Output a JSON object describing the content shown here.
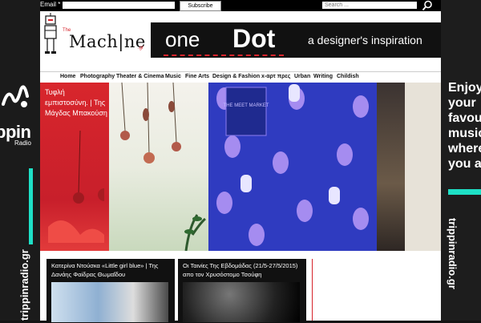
{
  "topbar": {
    "email_label": "Email *",
    "subscribe_label": "Subscribe",
    "search_placeholder": "Search ..."
  },
  "logo": {
    "small": "The",
    "text": "Mach|ne",
    "suffix": ".gr"
  },
  "banner": {
    "one": "one",
    "dot": "Dot",
    "tagline": "a designer's inspiration"
  },
  "nav": [
    "Home",
    "Photography",
    "Theater & Cinema",
    "Music",
    "Fine Arts",
    "Design & Fashion",
    "x-αρτ πρες",
    "Urban",
    "Writing",
    "Childish"
  ],
  "hero": {
    "caption": "Τυφλή εμπιστοσύνη. | Της Μάγδας Μπακούση",
    "poster_label": "THE MEET MARKET"
  },
  "articles": [
    {
      "title": "Κατερίνα Ντούσκα «Little girl blue» | Της Δανάης Φαίδρας Θωμαΐδου"
    },
    {
      "title": "Οι Ταινίες Της Εβδομάδας (21/5-27/5/2015) απο τον Χρυσόστομο Τσούφη"
    }
  ],
  "left_panel": {
    "brand": "ppin",
    "sub": "Radio",
    "vertical": "trippinradio.gr"
  },
  "right_panel": {
    "line1": "Enjoy",
    "line2": "your",
    "line3": "favou",
    "line4": "music",
    "line5": "where",
    "line6": "you ar",
    "vertical": "trippinradio.gr"
  },
  "colors": {
    "accent": "#1ee0c6",
    "brand_red": "#d6232b",
    "blue_pattern": "#2f3bc0"
  }
}
